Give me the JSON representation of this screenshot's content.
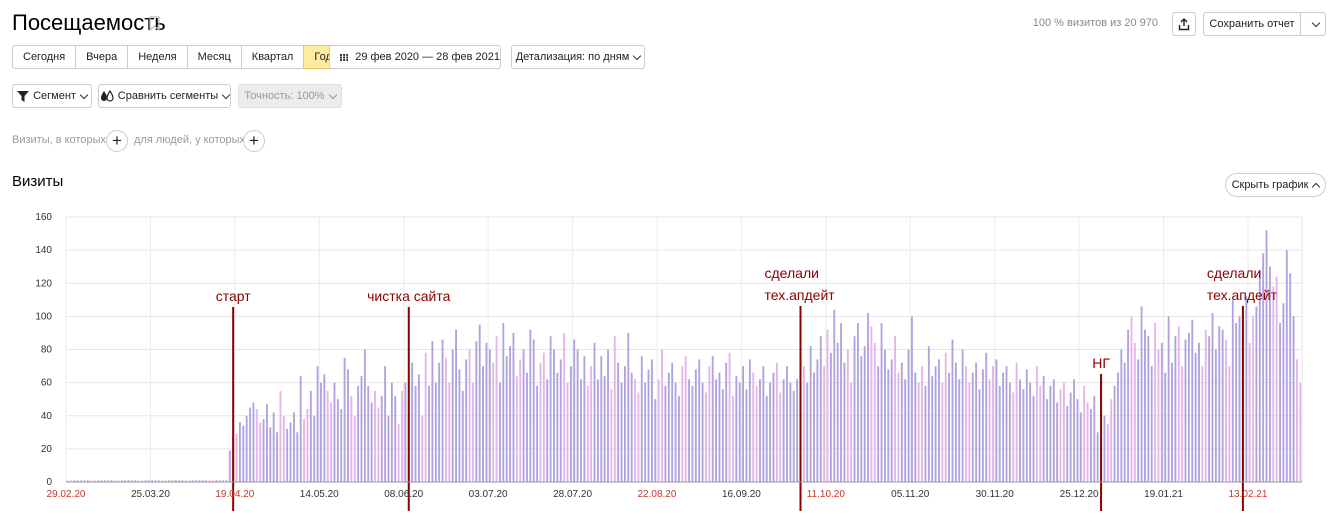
{
  "header": {
    "title": "Посещаемость",
    "visits_note": "100 % визитов из 20 970",
    "save_report": "Сохранить отчет"
  },
  "periods": [
    {
      "label": "Сегодня",
      "active": false
    },
    {
      "label": "Вчера",
      "active": false
    },
    {
      "label": "Неделя",
      "active": false
    },
    {
      "label": "Месяц",
      "active": false
    },
    {
      "label": "Квартал",
      "active": false
    },
    {
      "label": "Год",
      "active": true
    }
  ],
  "date_range": "29 фев 2020 — 28 фев 2021",
  "detail": "Детализация: по дням",
  "toolbar": {
    "segment": "Сегмент",
    "compare": "Сравнить сегменты",
    "accuracy": "Точность: 100%"
  },
  "filters": {
    "visits_label": "Визиты, в которых",
    "people_label": "для людей, у которых"
  },
  "section": {
    "title": "Визиты",
    "hide_chart": "Скрыть график"
  },
  "colors": {
    "accent": "#ffeba0",
    "bar_purple": "#b0a2de",
    "bar_pink": "#e7b3e8",
    "annotation": "#8b0000",
    "weekend_tick": "#c0392b"
  },
  "chart_data": {
    "type": "bar",
    "ylabel": "",
    "ylim": [
      0,
      160
    ],
    "yticks": [
      0,
      20,
      40,
      60,
      80,
      100,
      120,
      140,
      160
    ],
    "x_start": "2020-02-29",
    "x_end": "2021-02-28",
    "xticks": [
      {
        "date": "2020-02-29",
        "label": "29.02.20",
        "weekend": true
      },
      {
        "date": "2020-03-25",
        "label": "25.03.20",
        "weekend": false
      },
      {
        "date": "2020-04-19",
        "label": "19.04.20",
        "weekend": true
      },
      {
        "date": "2020-05-14",
        "label": "14.05.20",
        "weekend": false
      },
      {
        "date": "2020-06-08",
        "label": "08.06.20",
        "weekend": false
      },
      {
        "date": "2020-07-03",
        "label": "03.07.20",
        "weekend": false
      },
      {
        "date": "2020-07-28",
        "label": "28.07.20",
        "weekend": false
      },
      {
        "date": "2020-08-22",
        "label": "22.08.20",
        "weekend": true
      },
      {
        "date": "2020-09-16",
        "label": "16.09.20",
        "weekend": false
      },
      {
        "date": "2020-10-11",
        "label": "11.10.20",
        "weekend": true
      },
      {
        "date": "2020-11-05",
        "label": "05.11.20",
        "weekend": false
      },
      {
        "date": "2020-11-30",
        "label": "30.11.20",
        "weekend": false
      },
      {
        "date": "2020-12-25",
        "label": "25.12.20",
        "weekend": false
      },
      {
        "date": "2021-01-19",
        "label": "19.01.21",
        "weekend": false
      },
      {
        "date": "2021-02-13",
        "label": "13.02.21",
        "weekend": true
      }
    ],
    "annotations": [
      {
        "date": "2020-04-18",
        "text": [
          "старт"
        ]
      },
      {
        "date": "2020-06-09",
        "text": [
          "чистка сайта"
        ]
      },
      {
        "date": "2020-10-03",
        "text": [
          "сделали",
          "тех.апдейт"
        ]
      },
      {
        "date": "2020-12-31",
        "text": [
          "НГ"
        ]
      },
      {
        "date": "2021-02-11",
        "text": [
          "сделали",
          "тех.апдейт"
        ]
      }
    ],
    "series": [
      {
        "segments": [
          {
            "from": "2020-02-29",
            "to": "2020-04-16",
            "values": [
              1
            ]
          },
          {
            "from": "2020-04-17",
            "to": "2020-04-30",
            "values": [
              19,
              27,
              29,
              36,
              34,
              40,
              45,
              48,
              44,
              36,
              38,
              47,
              33,
              42
            ]
          },
          {
            "from": "2020-05-01",
            "to": "2020-05-31",
            "values": [
              30,
              55,
              40,
              32,
              36,
              42,
              30,
              64,
              38,
              44,
              55,
              40,
              70,
              60,
              65,
              55,
              48,
              60,
              50,
              44,
              75,
              68,
              52,
              40,
              58,
              64,
              80,
              58,
              48,
              55,
              45
            ]
          },
          {
            "from": "2020-06-01",
            "to": "2020-06-30",
            "values": [
              52,
              70,
              40,
              60,
              52,
              35,
              55,
              60,
              48,
              72,
              58,
              65,
              40,
              78,
              58,
              85,
              60,
              72,
              86,
              75,
              60,
              80,
              92,
              68,
              55,
              74,
              80,
              60,
              85,
              95
            ]
          },
          {
            "from": "2020-07-01",
            "to": "2020-07-31",
            "values": [
              70,
              84,
              80,
              72,
              88,
              60,
              96,
              76,
              82,
              90,
              64,
              74,
              80,
              66,
              92,
              86,
              58,
              72,
              78,
              62,
              88,
              80,
              66,
              74,
              90,
              60,
              70,
              86,
              80,
              62,
              76
            ]
          },
          {
            "from": "2020-08-01",
            "to": "2020-08-31",
            "values": [
              58,
              70,
              84,
              62,
              76,
              64,
              80,
              56,
              88,
              72,
              60,
              70,
              90,
              66,
              62,
              54,
              76,
              60,
              68,
              74,
              50,
              62,
              80,
              58,
              66,
              72,
              60,
              52,
              70,
              76,
              62
            ]
          },
          {
            "from": "2020-09-01",
            "to": "2020-09-30",
            "values": [
              58,
              68,
              74,
              60,
              54,
              70,
              76,
              62,
              66,
              56,
              72,
              78,
              52,
              64,
              60,
              70,
              56,
              74,
              66,
              58,
              62,
              70,
              52,
              60,
              66,
              72,
              54,
              62,
              70,
              60
            ]
          },
          {
            "from": "2020-10-01",
            "to": "2020-10-31",
            "values": [
              55,
              62,
              40,
              70,
              60,
              82,
              66,
              74,
              88,
              70,
              92,
              78,
              104,
              84,
              96,
              72,
              80,
              60,
              88,
              96,
              76,
              82,
              102,
              94,
              84,
              70,
              96,
              80,
              68,
              74,
              88
            ]
          },
          {
            "from": "2020-11-01",
            "to": "2020-11-30",
            "values": [
              66,
              72,
              62,
              80,
              100,
              66,
              60,
              70,
              58,
              82,
              64,
              70,
              74,
              60,
              78,
              66,
              86,
              72,
              62,
              80,
              70,
              60,
              66,
              72,
              56,
              68,
              78,
              62,
              70,
              74
            ]
          },
          {
            "from": "2020-12-01",
            "to": "2020-12-31",
            "values": [
              58,
              66,
              70,
              60,
              54,
              72,
              62,
              56,
              68,
              60,
              52,
              70,
              58,
              64,
              50,
              58,
              62,
              48,
              56,
              60,
              46,
              54,
              62,
              50,
              42,
              58,
              48,
              44,
              52,
              30,
              55
            ]
          },
          {
            "from": "2021-01-01",
            "to": "2021-01-31",
            "values": [
              40,
              35,
              50,
              58,
              66,
              80,
              72,
              92,
              100,
              84,
              74,
              106,
              92,
              88,
              70,
              96,
              80,
              84,
              66,
              100,
              72,
              88,
              94,
              70,
              86,
              90,
              98,
              78,
              84,
              70,
              92
            ]
          },
          {
            "from": "2021-02-01",
            "to": "2021-02-28",
            "values": [
              88,
              102,
              80,
              94,
              92,
              86,
              70,
              110,
              96,
              100,
              106,
              112,
              84,
              100,
              106,
              128,
              138,
              152,
              130,
              118,
              124,
              96,
              108,
              140,
              126,
              100,
              74,
              60
            ]
          }
        ]
      }
    ]
  }
}
